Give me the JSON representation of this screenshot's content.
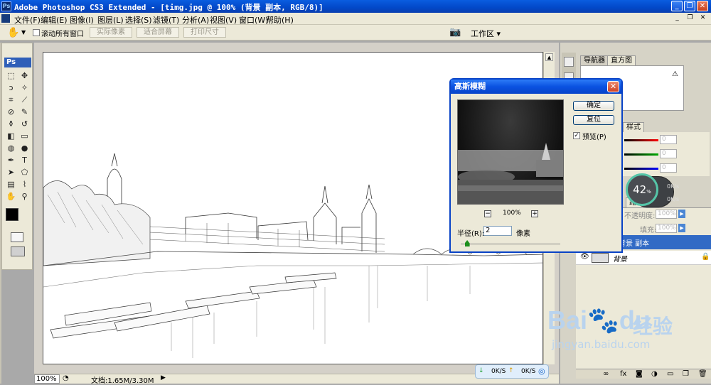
{
  "window": {
    "title": "Adobe Photoshop CS3 Extended - [timg.jpg @ 100% (背景 副本, RGB/8)]",
    "logo": "Ps",
    "minimize_glyph": "_",
    "restore_glyph": "❐",
    "close_glyph": "✕"
  },
  "menu": {
    "items": [
      "文件(F)",
      "编辑(E)",
      "图像(I)",
      "图层(L)",
      "选择(S)",
      "滤镜(T)",
      "分析(A)",
      "视图(V)",
      "窗口(W)",
      "帮助(H)"
    ]
  },
  "options": {
    "scroll_all_label": "滚动所有窗口",
    "actual_pixels": "实际像素",
    "fit_screen": "适合屏幕",
    "print_size": "打印尺寸",
    "workspace": "工作区 ▾"
  },
  "toolbox": {
    "logo": "Ps",
    "tools": [
      {
        "name": "marquee-tool-icon",
        "glyph": "⬚"
      },
      {
        "name": "move-tool-icon",
        "glyph": "✥"
      },
      {
        "name": "lasso-tool-icon",
        "glyph": "ↄ"
      },
      {
        "name": "magic-wand-tool-icon",
        "glyph": "✧"
      },
      {
        "name": "crop-tool-icon",
        "glyph": "⌗"
      },
      {
        "name": "slice-tool-icon",
        "glyph": "⟋"
      },
      {
        "name": "healing-brush-icon",
        "glyph": "⊘"
      },
      {
        "name": "brush-tool-icon",
        "glyph": "✎"
      },
      {
        "name": "clone-stamp-icon",
        "glyph": "⚱"
      },
      {
        "name": "history-brush-icon",
        "glyph": "↺"
      },
      {
        "name": "eraser-tool-icon",
        "glyph": "◧"
      },
      {
        "name": "gradient-tool-icon",
        "glyph": "▭"
      },
      {
        "name": "blur-tool-icon",
        "glyph": "◍"
      },
      {
        "name": "dodge-tool-icon",
        "glyph": "●"
      },
      {
        "name": "pen-tool-icon",
        "glyph": "✒"
      },
      {
        "name": "type-tool-icon",
        "glyph": "T"
      },
      {
        "name": "path-select-icon",
        "glyph": "➤"
      },
      {
        "name": "shape-tool-icon",
        "glyph": "⬠"
      },
      {
        "name": "notes-tool-icon",
        "glyph": "▤"
      },
      {
        "name": "eyedropper-icon",
        "glyph": "⌇"
      },
      {
        "name": "hand-tool-icon",
        "glyph": "✋"
      },
      {
        "name": "zoom-tool-icon",
        "glyph": "⚲"
      }
    ]
  },
  "status": {
    "zoom": "100%",
    "doc": "文档:1.65M/3.30M"
  },
  "panels": {
    "navigator_tab": "导航器",
    "histogram_tab": "直方图",
    "styles_tab": "样式",
    "channel_values": [
      "0",
      "0",
      "0"
    ],
    "paths_tab": "路径",
    "opacity_label": "不透明度:",
    "opacity_value": "100%",
    "fill_label": "填充:",
    "fill_value": "100%",
    "layers": [
      {
        "name": "背景 副本",
        "selected": true
      },
      {
        "name": "背景",
        "selected": false
      }
    ]
  },
  "dialog": {
    "title": "高斯模糊",
    "ok": "确定",
    "reset": "复位",
    "preview_label": "预览(P)",
    "preview_checked": true,
    "zoom": "100%",
    "radius_label": "半径(R):",
    "radius_value": "2",
    "unit": "像素",
    "radius_fraction": 0.04
  },
  "speed_widget": {
    "percent": "42",
    "percent_sign": "%",
    "up": "0K/s",
    "down": "0K/s"
  },
  "speed_bar": {
    "down": "0K/S",
    "up": "0K/S"
  },
  "watermark": {
    "brand": "Bai",
    "brand2": "du",
    "cn": "经验",
    "url": "jingyan.baidu.com"
  }
}
